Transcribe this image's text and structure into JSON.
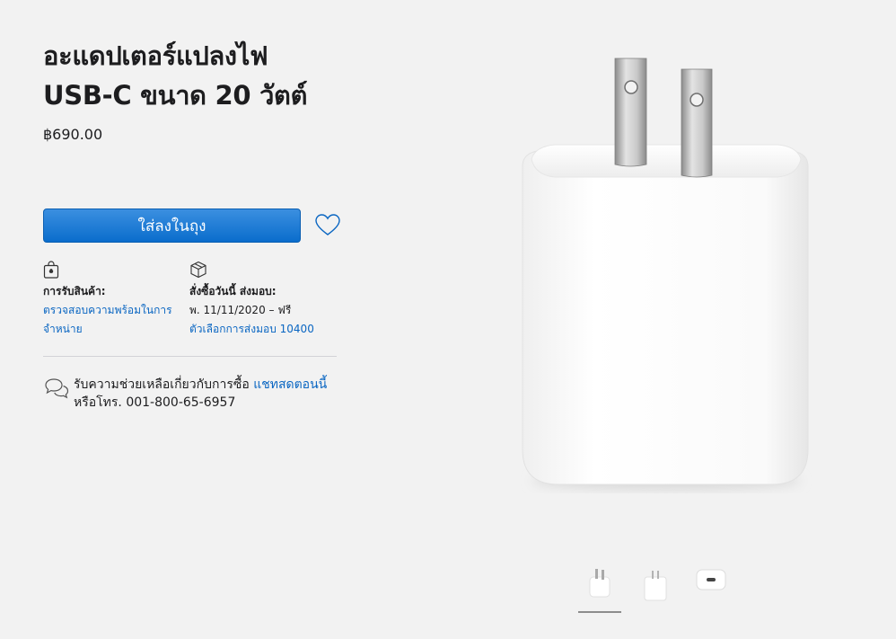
{
  "product": {
    "title": "อะแดปเตอร์แปลงไฟ USB-C ขนาด 20 วัตต์",
    "price": "฿690.00"
  },
  "actions": {
    "add_to_bag_label": "ใส่ลงในถุง"
  },
  "pickup": {
    "heading": "การรับสินค้า:",
    "link": "ตรวจสอบความพร้อมในการจำหน่าย"
  },
  "delivery": {
    "heading": "สั่งซื้อวันนี้ ส่งมอบ:",
    "date_text": "พ. 11/11/2020 – ฟรี",
    "options_link": "ตัวเลือกการส่งมอบ",
    "postcode": "10400"
  },
  "help": {
    "text": "รับความช่วยเหลือเกี่ยวกับการซื้อ",
    "chat_link": "แชทสดตอนนี้",
    "phone_text": "หรือโทร. 001-800-65-6957"
  },
  "gallery": {
    "thumbnails": [
      "front",
      "side",
      "port"
    ],
    "selected_index": 0
  },
  "colors": {
    "accent": "#0a66c2",
    "button": "#0a6dcc",
    "background": "#f2f2f2"
  },
  "icons": [
    "apple-bag-icon",
    "package-box-icon",
    "heart-icon",
    "chat-bubbles-icon"
  ]
}
